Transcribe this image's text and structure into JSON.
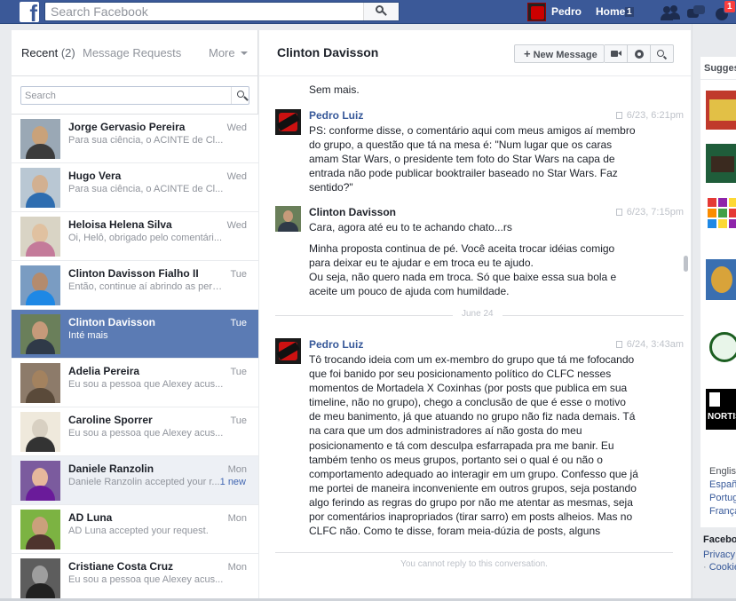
{
  "topbar": {
    "logo": "f",
    "search_placeholder": "Search Facebook",
    "user_name": "Pedro",
    "home_label": "Home",
    "home_count": "1",
    "notif_count": "1",
    "user_pic_text": "PEDRON LANNE",
    "icons": [
      "search-icon",
      "friend-requests-icon",
      "messages-icon",
      "notifications-icon"
    ],
    "bg_color": "#3b5998"
  },
  "left": {
    "tab_recent": "Recent",
    "tab_recent_count": "(2)",
    "tab_requests": "Message Requests",
    "tab_more": "More",
    "search_placeholder": "Search",
    "threads": [
      {
        "name": "Jorge Gervasio Pereira",
        "snippet": "Para sua ciência, o ACINTE de Cl...",
        "date": "Wed",
        "new": "",
        "state": "read"
      },
      {
        "name": "Hugo Vera",
        "snippet": "Para sua ciência, o ACINTE de Cl...",
        "date": "Wed",
        "new": "",
        "state": "read"
      },
      {
        "name": "Heloisa Helena Silva",
        "snippet": "Oi, Helô, obrigado pelo comentári...",
        "date": "Wed",
        "new": "",
        "state": "read"
      },
      {
        "name": "Clinton Davisson Fialho II",
        "snippet": "Então, continue aí abrindo as pern...",
        "date": "Tue",
        "new": "",
        "state": "read"
      },
      {
        "name": "Clinton Davisson",
        "snippet": "Inté mais",
        "date": "Tue",
        "new": "",
        "state": "active"
      },
      {
        "name": "Adelia Pereira",
        "snippet": "Eu sou a pessoa que Alexey acus...",
        "date": "Tue",
        "new": "",
        "state": "read"
      },
      {
        "name": "Caroline Sporrer",
        "snippet": "Eu sou a pessoa que Alexey acus...",
        "date": "Tue",
        "new": "",
        "state": "read"
      },
      {
        "name": "Daniele Ranzolin",
        "snippet": "Daniele Ranzolin accepted your r...",
        "date": "Mon",
        "new": "1 new",
        "state": "unread"
      },
      {
        "name": "AD Luna",
        "snippet": "AD Luna accepted your request.",
        "date": "Mon",
        "new": "",
        "state": "read"
      },
      {
        "name": "Cristiane Costa Cruz",
        "snippet": "Eu sou a pessoa que Alexey acus...",
        "date": "Mon",
        "new": "",
        "state": "read"
      }
    ]
  },
  "conversation": {
    "title": "Clinton Davisson",
    "new_message_label": "New Message",
    "top_text": "Sem mais.",
    "messages": [
      {
        "sender": "Pedro Luiz",
        "time": "6/23, 6:21pm",
        "paragraphs": [
          "PS: conforme disse, o comentário aqui com meus amigos aí membro do grupo, a questão que tá na mesa é: \"Num lugar que os caras amam Star Wars, o presidente tem foto do Star Wars na capa de entrada não pode publicar booktrailer baseado no Star Wars. Faz sentido?\""
        ]
      },
      {
        "sender": "Clinton Davisson",
        "time": "6/23, 7:15pm",
        "paragraphs": [
          "Cara, agora até eu to te achando chato...rs",
          "Minha proposta continua de pé. Você aceita trocar idéias comigo para deixar eu te ajudar e em troca eu te ajudo.",
          "Ou seja, não quero nada em troca. Só que baixe essa sua bola e aceite um pouco de ajuda com humildade."
        ]
      },
      {
        "sender": "Pedro Luiz",
        "time": "6/24, 3:43am",
        "paragraphs": [
          "Tô trocando ideia com um ex-membro do grupo que tá me fofocando que foi banido por seu posicionamento político do CLFC nesses momentos de Mortadela X Coxinhas (por posts que publica em sua timeline, não no grupo), chego a conclusão de que é esse o motivo de meu banimento, já que atuando no grupo não fiz nada demais. Tá na cara que um dos administradores aí não gosta do meu posicionamento e tá com desculpa esfarrapada pra me banir. Eu também tenho os meus grupos, portanto sei o qual é ou não o comportamento adequado ao interagir em um grupo. Confesso que já me portei de maneira inconveniente em outros grupos, seja postando algo ferindo as regras do grupo por não me atentar as mesmas, seja por comentários inapropriados (tirar sarro) em posts alheios. Mas no CLFC não. Como te disse, foram meia-dúzia de posts, alguns enaltecendo o trabalho de outros escritores, de modo"
        ]
      }
    ],
    "day_separator": "June 24",
    "reply_notice": "You cannot reply to this conversation."
  },
  "right": {
    "sugg_title": "Sugges",
    "sugg_6_text": "NORTIST",
    "lang_current": "English",
    "langs": [
      "Españ",
      "Portug",
      "França"
    ],
    "footer_title": "Faceboo",
    "footer_privacy": "Privacy",
    "footer_cookies_sep": "·",
    "footer_cookies": "Cookie"
  }
}
